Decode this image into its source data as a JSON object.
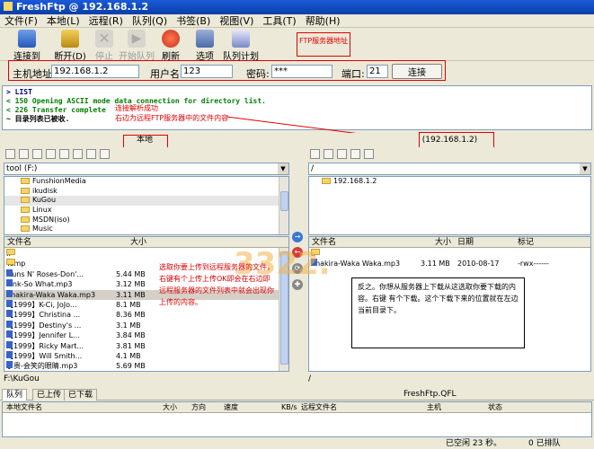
{
  "window": {
    "title": "FreshFtp @ 192.168.1.2"
  },
  "menu": [
    "文件(F)",
    "本地(L)",
    "远程(R)",
    "队列(Q)",
    "书签(B)",
    "视图(V)",
    "工具(T)",
    "帮助(H)"
  ],
  "toolbar": [
    {
      "label": "连接到",
      "icon": "connect-icon",
      "enabled": true
    },
    {
      "label": "断开(D)",
      "icon": "disconnect-icon",
      "enabled": true
    },
    {
      "label": "停止",
      "icon": "stop-icon",
      "enabled": false
    },
    {
      "label": "开始队列",
      "icon": "start-queue-icon",
      "enabled": false
    },
    {
      "label": "刷新",
      "icon": "refresh-icon",
      "enabled": true
    },
    {
      "label": "选项",
      "icon": "options-icon",
      "enabled": true
    },
    {
      "label": "队列计划",
      "icon": "queue-schedule-icon",
      "enabled": true
    }
  ],
  "connection": {
    "host_label": "主机地址:",
    "host_value": "192.168.1.2",
    "user_label": "用户名:",
    "user_value": "123",
    "password_label": "密码:",
    "password_value": "***",
    "port_label": "端口:",
    "port_value": "21",
    "connect_button": "连接"
  },
  "log": [
    {
      "type": "cmd",
      "text": "> LIST"
    },
    {
      "type": "resp",
      "text": "< 150 Opening ASCII mode data connection for directory list."
    },
    {
      "type": "resp",
      "text": "< 226 Transfer complete"
    },
    {
      "type": "info",
      "text": "~ 目录列表已被收."
    }
  ],
  "annotations": {
    "ftp_address": "FTP服务器地址",
    "parse_success": "连接解析成功",
    "right_side": "右边为远程FTP服务器中的文件内容",
    "local_upload": "选取你要上传到远程服务器的文件，右键有个上传上传OK即会在右边即远程服务器的文件列表中就会出现你上传的内容。",
    "remote_download": "反之。你想从服务器上下载从这选取你要下载的内容。右键 有个下载。这个下载下来的位置就在左边当前目录下。"
  },
  "local": {
    "header": "本地",
    "drive": "tool (F:)",
    "tree": [
      "FunshionMedia",
      "ikudisk",
      "KuGou",
      "Linux",
      "MSDN(iso)",
      "Music"
    ],
    "columns": {
      "name": "文件名",
      "size": "大小"
    },
    "files": [
      {
        "name": "..",
        "size": "",
        "kind": "folder"
      },
      {
        "name": "Temp",
        "size": "",
        "kind": "folder"
      },
      {
        "name": "Guns N' Roses-Don'...",
        "size": "5.44 MB",
        "kind": "file"
      },
      {
        "name": "Pink-So What.mp3",
        "size": "3.12 MB",
        "kind": "file"
      },
      {
        "name": "Shakira-Waka Waka.mp3",
        "size": "3.11 MB",
        "kind": "file"
      },
      {
        "name": "【1999】K-Ci, JoJo...",
        "size": "8.1 MB",
        "kind": "file"
      },
      {
        "name": "【1999】Christina ...",
        "size": "8.36 MB",
        "kind": "file"
      },
      {
        "name": "【1999】Destiny's ...",
        "size": "3.1 MB",
        "kind": "file"
      },
      {
        "name": "【1999】Jennifer L...",
        "size": "3.84 MB",
        "kind": "file"
      },
      {
        "name": "【1999】Ricky Mart...",
        "size": "3.81 MB",
        "kind": "file"
      },
      {
        "name": "【1999】Will Smith...",
        "size": "4.1 MB",
        "kind": "file"
      },
      {
        "name": "丁贵-会笑的眼睛.mp3",
        "size": "5.69 MB",
        "kind": "file"
      }
    ],
    "status": "F:\\KuGou"
  },
  "remote": {
    "header": "(192.168.1.2)",
    "path": "/",
    "tree": [
      "192.168.1.2"
    ],
    "columns": {
      "name": "文件名",
      "size": "大小",
      "date": "日期",
      "flags": "标记"
    },
    "files": [
      {
        "name": "..",
        "size": "",
        "date": "",
        "flags": "",
        "kind": "folder"
      },
      {
        "name": "Shakira-Waka Waka.mp3",
        "size": "3.11 MB",
        "date": "2010-08-17",
        "flags": "-rwx------",
        "kind": "file"
      }
    ],
    "status": "/"
  },
  "transfer_buttons": [
    {
      "symbol": "→",
      "color": "#3a78d8"
    },
    {
      "symbol": "←",
      "color": "#d83a3a"
    },
    {
      "symbol": "⟳",
      "color": "#888888"
    },
    {
      "symbol": "✚",
      "color": "#888888"
    }
  ],
  "queue": {
    "tabs": [
      "队列",
      "已上传",
      "已下载"
    ],
    "file_label": "FreshFtp.QFL",
    "columns": [
      "本地文件名",
      "大小",
      "方向",
      "速度",
      "KB/s",
      "远程文件名",
      "主机",
      "状态"
    ]
  },
  "bottom": {
    "free": "已空闲 23 秒。",
    "count": "0 已排队"
  },
  "watermark": "3322.cc"
}
